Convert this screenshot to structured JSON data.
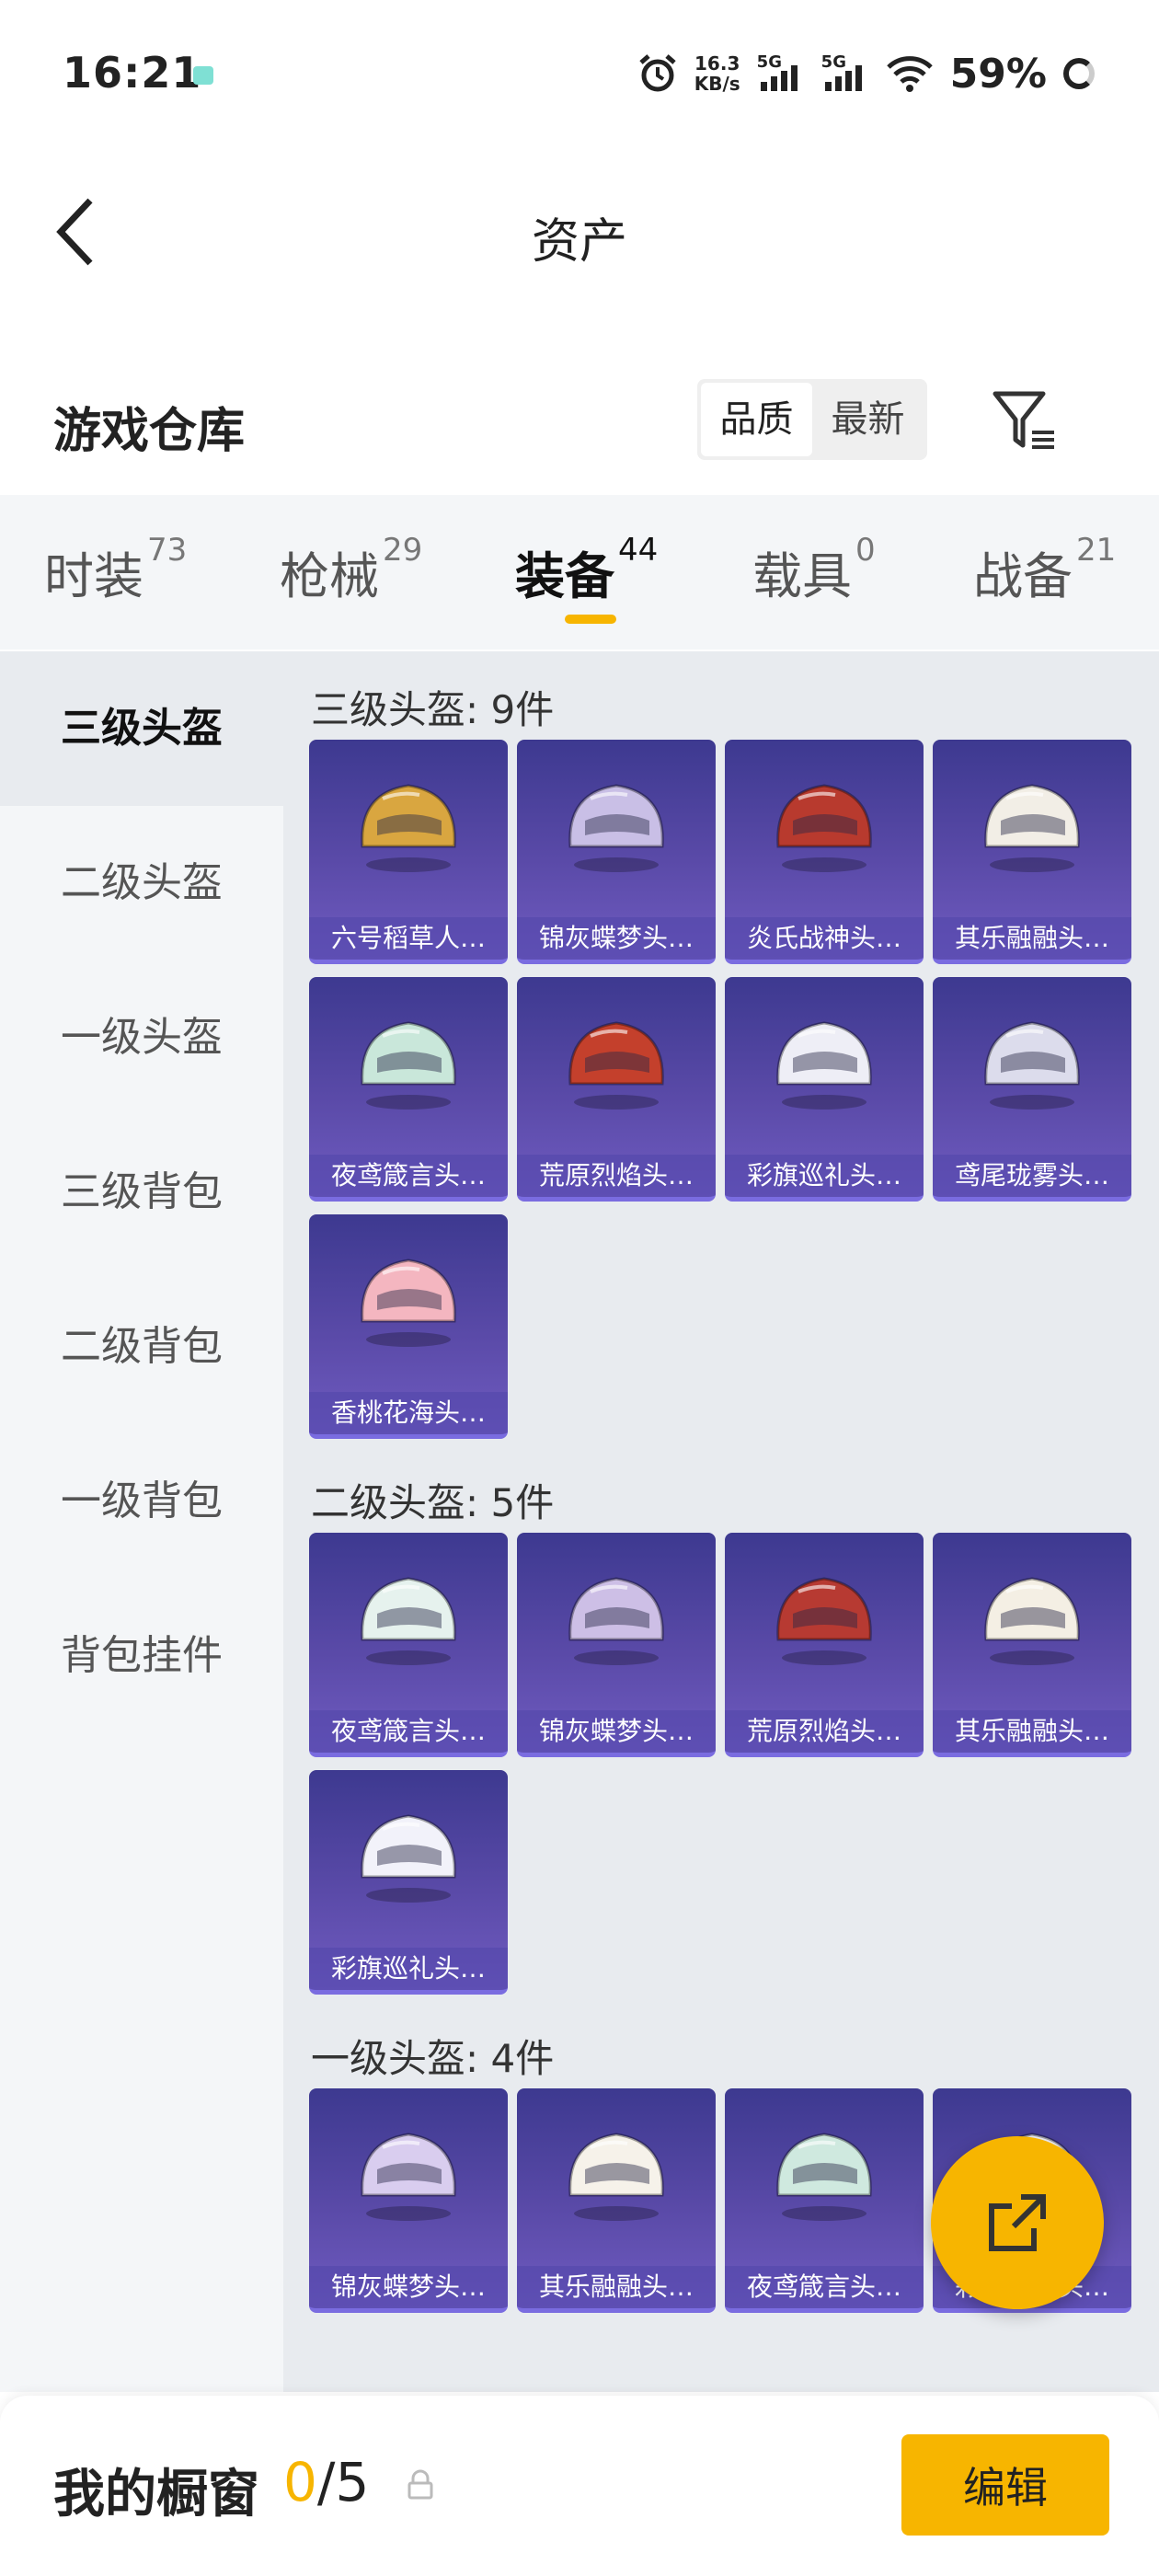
{
  "status_bar": {
    "time": "16:21",
    "net_speed_value": "16.3",
    "net_speed_unit": "KB/s",
    "sim1": "5G",
    "sim2": "5G",
    "battery": "59%"
  },
  "header": {
    "title": "资产"
  },
  "warehouse": {
    "title": "游戏仓库",
    "sort_options": [
      "品质",
      "最新"
    ],
    "selected_sort": "品质"
  },
  "tabs": [
    {
      "label": "时装",
      "count": "73"
    },
    {
      "label": "枪械",
      "count": "29"
    },
    {
      "label": "装备",
      "count": "44"
    },
    {
      "label": "载具",
      "count": "0"
    },
    {
      "label": "战备",
      "count": "21"
    }
  ],
  "active_tab": "装备",
  "sidebar": {
    "items": [
      "三级头盔",
      "二级头盔",
      "一级头盔",
      "三级背包",
      "二级背包",
      "一级背包",
      "背包挂件"
    ],
    "active": "三级头盔"
  },
  "sections": [
    {
      "title": "三级头盔: 9件",
      "items": [
        "六号稻草人…",
        "锦灰蝶梦头…",
        "炎氏战神头…",
        "其乐融融头…",
        "夜鸢箴言头…",
        "荒原烈焰头…",
        "彩旗巡礼头…",
        "鸢尾珑雾头…",
        "香桃花海头…"
      ]
    },
    {
      "title": "二级头盔: 5件",
      "items": [
        "夜鸢箴言头…",
        "锦灰蝶梦头…",
        "荒原烈焰头…",
        "其乐融融头…",
        "彩旗巡礼头…"
      ]
    },
    {
      "title": "一级头盔: 4件",
      "items": [
        "锦灰蝶梦头…",
        "其乐融融头…",
        "夜鸢箴言头…",
        "彩旗巡礼头…"
      ]
    }
  ],
  "bottom": {
    "label": "我的橱窗",
    "current": "0",
    "separator": "/",
    "max": "5",
    "edit_label": "编辑"
  },
  "colors": {
    "accent": "#f7b500",
    "card_top": "#3d3990",
    "card_bottom": "#6f5bc0"
  }
}
